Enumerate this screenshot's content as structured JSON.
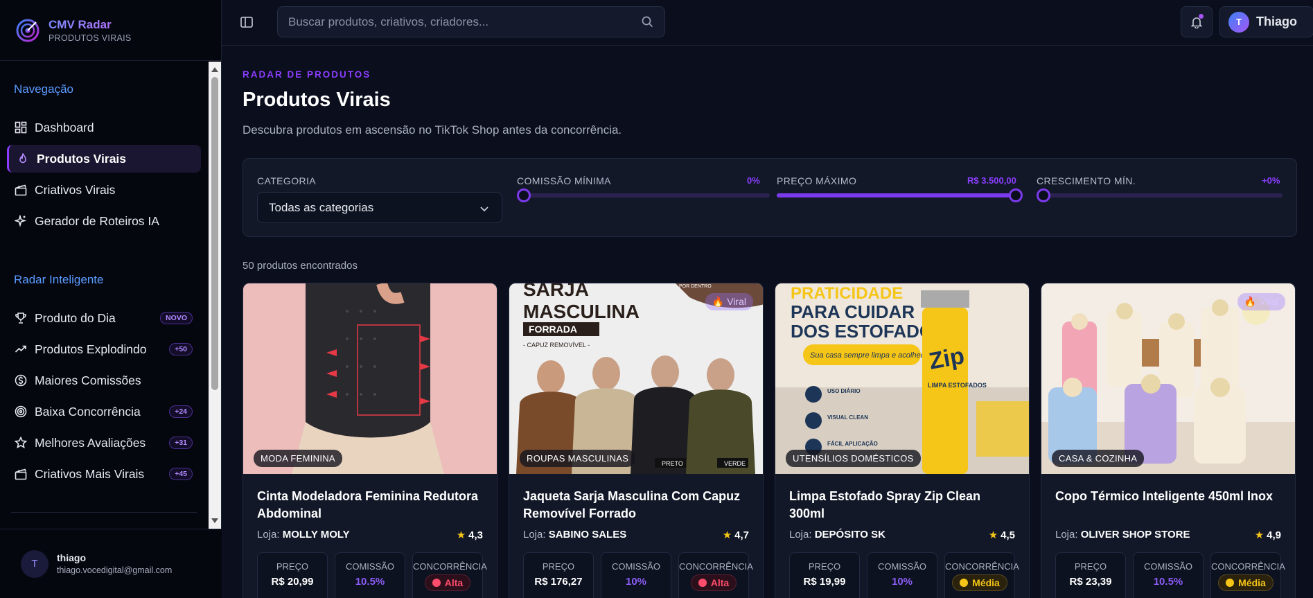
{
  "brand": {
    "title": "CMV Radar",
    "subtitle": "PRODUTOS VIRAIS"
  },
  "sidebar": {
    "section_nav": "Navegação",
    "nav_items": [
      {
        "label": "Dashboard",
        "icon": "dashboard-icon"
      },
      {
        "label": "Produtos Virais",
        "icon": "flame-icon",
        "active": true
      },
      {
        "label": "Criativos Virais",
        "icon": "clapperboard-icon"
      },
      {
        "label": "Gerador de Roteiros IA",
        "icon": "sparkles-icon"
      }
    ],
    "section_radar": "Radar Inteligente",
    "radar_items": [
      {
        "label": "Produto do Dia",
        "badge": "NOVO",
        "icon": "trophy-icon"
      },
      {
        "label": "Produtos Explodindo",
        "badge": "+50",
        "icon": "trending-up-icon"
      },
      {
        "label": "Maiores Comissões",
        "badge": "",
        "icon": "dollar-circle-icon"
      },
      {
        "label": "Baixa Concorrência",
        "badge": "+24",
        "icon": "target-icon"
      },
      {
        "label": "Melhores Avaliações",
        "badge": "+31",
        "icon": "star-icon"
      },
      {
        "label": "Criativos Mais Virais",
        "badge": "+45",
        "icon": "clapperboard-icon"
      }
    ],
    "user": {
      "initial": "T",
      "name": "thiago",
      "email": "thiago.vocedigital@gmail.com"
    }
  },
  "topbar": {
    "search_placeholder": "Buscar produtos, criativos, criadores...",
    "user_initial": "T",
    "user_name": "Thiago"
  },
  "page": {
    "eyebrow": "RADAR DE PRODUTOS",
    "title": "Produtos Virais",
    "description": "Descubra produtos em ascensão no TikTok Shop antes da concorrência."
  },
  "filters": {
    "category_label": "CATEGORIA",
    "category_value": "Todas as categorias",
    "commission_label": "COMISSÃO MÍNIMA",
    "commission_value": "0%",
    "commission_fraction": 0,
    "price_label": "PREÇO MÁXIMO",
    "price_value": "R$ 3.500,00",
    "price_fraction": 1,
    "growth_label": "CRESCIMENTO MÍN.",
    "growth_value": "+0%",
    "growth_fraction": 0
  },
  "results_count": "50 produtos encontrados",
  "labels": {
    "store_prefix": "Loja:",
    "price": "PREÇO",
    "commission": "COMISSÃO",
    "competition": "CONCORRÊNCIA",
    "viral": "Viral"
  },
  "products": [
    {
      "category": "MODA FEMININA",
      "title": "Cinta Modeladora Feminina Redutora Abdominal",
      "store": "MOLLY MOLY",
      "rating": "4,3",
      "price": "R$ 20,99",
      "commission": "10.5%",
      "competition": "Alta",
      "viral": false
    },
    {
      "category": "ROUPAS MASCULINAS",
      "title": "Jaqueta Sarja Masculina Com Capuz Removível Forrado",
      "store": "SABINO SALES",
      "rating": "4,7",
      "price": "R$ 176,27",
      "commission": "10%",
      "competition": "Alta",
      "viral": true,
      "image_text": {
        "headline_1": "SARJA",
        "headline_2": "MASCULINA",
        "tag": "FORRADA",
        "sub": "- CAPUZ REMOVÍVEL -",
        "corner": "POR DENTRO",
        "swatch_1": "PRETO",
        "swatch_2": "VERDE"
      }
    },
    {
      "category": "UTENSÍLIOS DOMÉSTICOS",
      "title": "Limpa Estofado Spray Zip Clean 300ml",
      "store": "DEPÓSITO SK",
      "rating": "4,5",
      "price": "R$ 19,99",
      "commission": "10%",
      "competition": "Média",
      "viral": false,
      "image_text": {
        "headline_1": "PRATICIDADE",
        "headline_2": "PARA CUIDAR",
        "headline_3": "DOS ESTOFADOS",
        "tagline": "Sua casa sempre limpa e acolhedora!",
        "feature_1": "USO DIÁRIO",
        "feature_2": "VISUAL CLEAN",
        "feature_3": "FÁCIL APLICAÇÃO",
        "can_brand": "Zip",
        "can_sub": "LIMPA ESTOFADOS"
      }
    },
    {
      "category": "CASA & COZINHA",
      "title": "Copo Térmico Inteligente 450ml Inox",
      "store": "OLIVER SHOP STORE",
      "rating": "4,9",
      "price": "R$ 23,39",
      "commission": "10.5%",
      "competition": "Média",
      "viral": true
    }
  ],
  "colors": {
    "accent": "#8b3dff",
    "background": "#0b0f1d",
    "card": "#121828",
    "alta": "#ff4d6d",
    "media": "#f5c518",
    "section": "#5b9bff"
  }
}
